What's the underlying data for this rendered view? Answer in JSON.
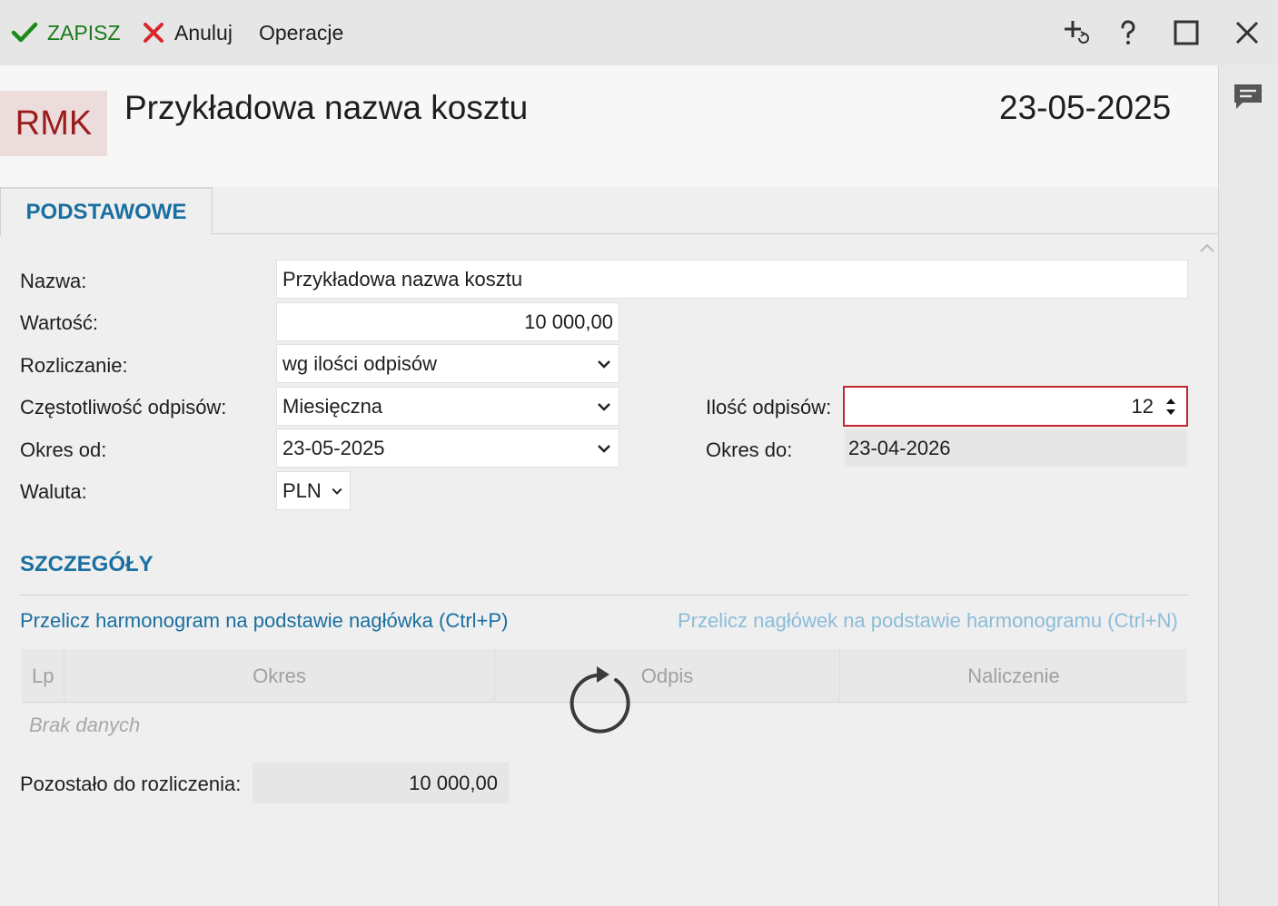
{
  "toolbar": {
    "save_label": "ZAPISZ",
    "cancel_label": "Anuluj",
    "operations_label": "Operacje",
    "icons": [
      "add-refresh-icon",
      "help-icon",
      "maximize-icon",
      "close-icon"
    ],
    "save_color": "#1a7a1a",
    "cancel_color": "#d9262e"
  },
  "header": {
    "badge": "RMK",
    "title": "Przykładowa nazwa kosztu",
    "date": "23-05-2025"
  },
  "tabs": [
    {
      "label": "PODSTAWOWE",
      "active": true
    }
  ],
  "form": {
    "name": {
      "label": "Nazwa:",
      "value": "Przykładowa nazwa kosztu"
    },
    "value": {
      "label": "Wartość:",
      "value": "10 000,00"
    },
    "settlement": {
      "label": "Rozliczanie:",
      "value": "wg ilości odpisów"
    },
    "frequency": {
      "label": "Częstotliwość odpisów:",
      "value": "Miesięczna"
    },
    "count": {
      "label": "Ilość odpisów:",
      "value": "12"
    },
    "period_from": {
      "label": "Okres od:",
      "value": "23-05-2025"
    },
    "period_to": {
      "label": "Okres do:",
      "value": "23-04-2026"
    },
    "currency": {
      "label": "Waluta:",
      "value": "PLN"
    }
  },
  "details": {
    "title": "SZCZEGÓŁY",
    "link_recalc_schedule": "Przelicz harmonogram na podstawie nagłówka (Ctrl+P)",
    "link_recalc_header": "Przelicz nagłówek na podstawie harmonogramu (Ctrl+N)",
    "columns": [
      "Lp",
      "Okres",
      "Odpis",
      "Naliczenie"
    ],
    "empty_text": "Brak danych",
    "remaining_label": "Pozostało do rozliczenia:",
    "remaining_value": "10 000,00"
  },
  "colors": {
    "accent": "#1a6fa0",
    "badge_bg": "#ecdcdc",
    "badge_text": "#9b1c1c",
    "focus_border": "#c4262e"
  }
}
